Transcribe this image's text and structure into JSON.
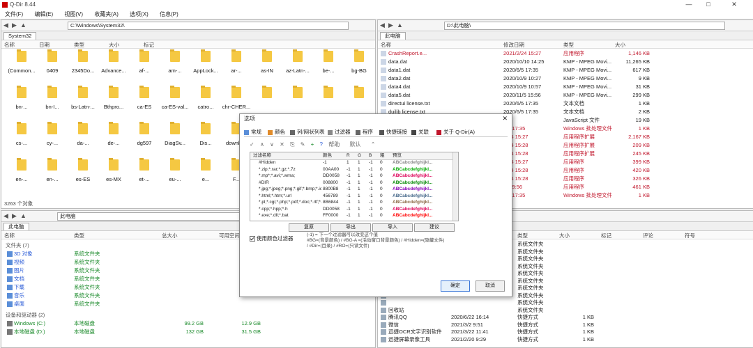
{
  "window": {
    "title": "Q-Dir 8.44"
  },
  "menu": [
    "文件(F)",
    "编辑(E)",
    "视图(V)",
    "收藏夹(A)",
    "选项(X)",
    "信息(P)"
  ],
  "pane_tl": {
    "path": "C:\\Windows\\System32\\",
    "tab": "System32",
    "cols": [
      "名称",
      "日期",
      "类型",
      "大小",
      "标记"
    ],
    "items": [
      "(Common...",
      "0409",
      "2345Do...",
      "Advance...",
      "af-...",
      "am-...",
      "AppLock...",
      "ar-...",
      "as-IN",
      "az-Latn-...",
      "be-...",
      "bg-BG",
      "bn-...",
      "bn-I...",
      "bs-Latn-...",
      "Bthpro...",
      "ca-ES",
      "ca-ES-val...",
      "catro...",
      "chr-CHER...",
      "",
      "",
      "",
      "",
      "cs-...",
      "cy-...",
      "da-...",
      "de-...",
      "dg597",
      "DiagSv...",
      "Dis...",
      "downla...",
      "",
      "",
      "",
      "",
      "en-...",
      "en-...",
      "es-ES",
      "es-MX",
      "et-...",
      "eu-...",
      "e...",
      "F...",
      "",
      "",
      "",
      ""
    ],
    "status": "3263 个对象"
  },
  "pane_tr": {
    "path": "D:\\此电脑\\",
    "tab": "此电脑",
    "cols": [
      "名称",
      "修改日期",
      "类型",
      "大小"
    ],
    "rows": [
      {
        "name": "CrashReport.e...",
        "date": "2021/2/24 15:27",
        "type": "应用程序",
        "size": "1,146 KB",
        "style": "red"
      },
      {
        "name": "data.dat",
        "date": "2020/10/10 14:25",
        "type": "KMP - MPEG Movi...",
        "size": "11,265 KB",
        "style": ""
      },
      {
        "name": "data1.dat",
        "date": "2020/6/5 17:35",
        "type": "KMP - MPEG Movi...",
        "size": "617 KB",
        "style": ""
      },
      {
        "name": "data2.dat",
        "date": "2020/10/9 10:27",
        "type": "KMP - MPEG Movi...",
        "size": "9 KB",
        "style": ""
      },
      {
        "name": "data4.dat",
        "date": "2020/10/9 10:57",
        "type": "KMP - MPEG Movi...",
        "size": "31 KB",
        "style": ""
      },
      {
        "name": "data5.dat",
        "date": "2020/11/5 15:56",
        "type": "KMP - MPEG Movi...",
        "size": "299 KB",
        "style": ""
      },
      {
        "name": "directui license.txt",
        "date": "2020/6/5 17:35",
        "type": "文本文档",
        "size": "1 KB",
        "style": ""
      },
      {
        "name": "duilib license.txt",
        "date": "2020/6/5 17:35",
        "type": "文本文档",
        "size": "2 KB",
        "style": ""
      },
      {
        "name": "",
        "date": "",
        "type": "JavaScript 文件",
        "size": "19 KB",
        "style": ""
      },
      {
        "name": "",
        "date": "6/5 17:35",
        "type": "Windows 批处理文件",
        "size": "1 KB",
        "style": "red"
      },
      {
        "name": "",
        "date": "2/24 15:27",
        "type": "应用程序扩展",
        "size": "2,167 KB",
        "style": "red"
      },
      {
        "name": "",
        "date": "2/24 15:28",
        "type": "应用程序扩展",
        "size": "209 KB",
        "style": "red"
      },
      {
        "name": "",
        "date": "2/24 15:28",
        "type": "应用程序扩展",
        "size": "245 KB",
        "style": "red"
      },
      {
        "name": "",
        "date": "2/24 15:27",
        "type": "应用程序",
        "size": "399 KB",
        "style": "red"
      },
      {
        "name": "",
        "date": "2/24 15:28",
        "type": "应用程序",
        "size": "420 KB",
        "style": "red"
      },
      {
        "name": "",
        "date": "2/24 15:28",
        "type": "应用程序",
        "size": "326 KB",
        "style": "red"
      },
      {
        "name": "",
        "date": "3/2 9:56",
        "type": "应用程序",
        "size": "461 KB",
        "style": "red"
      },
      {
        "name": "",
        "date": "6/5 17:35",
        "type": "Windows 批处理文件",
        "size": "1 KB",
        "style": "red"
      }
    ]
  },
  "pane_bl": {
    "path": "此电脑",
    "tab": "此电脑",
    "cols": [
      "名称",
      "类型",
      "总大小",
      "可用空间"
    ],
    "section_folders": "文件夹 (7)",
    "folders": [
      {
        "name": "3D 对象",
        "type": "系统文件夹"
      },
      {
        "name": "视频",
        "type": "系统文件夹"
      },
      {
        "name": "图片",
        "type": "系统文件夹"
      },
      {
        "name": "文档",
        "type": "系统文件夹"
      },
      {
        "name": "下载",
        "type": "系统文件夹"
      },
      {
        "name": "音乐",
        "type": "系统文件夹"
      },
      {
        "name": "桌面",
        "type": "系统文件夹"
      }
    ],
    "section_drives": "设备和驱动器 (2)",
    "drives": [
      {
        "name": "Windows (C:)",
        "type": "本地磁盘",
        "total": "99.2 GB",
        "free": "12.9 GB"
      },
      {
        "name": "本地磁盘 (D:)",
        "type": "本地磁盘",
        "total": "132 GB",
        "free": "31.5 GB"
      }
    ]
  },
  "pane_br": {
    "cols": [
      "类型",
      "大小",
      "标记",
      "评论",
      "符号"
    ],
    "rows": [
      {
        "name": "",
        "date": "",
        "type": "系统文件夹",
        "size": ""
      },
      {
        "name": "",
        "date": "",
        "type": "系统文件夹",
        "size": ""
      },
      {
        "name": "",
        "date": "",
        "type": "系统文件夹",
        "size": ""
      },
      {
        "name": "",
        "date": "",
        "type": "系统文件夹",
        "size": ""
      },
      {
        "name": "",
        "date": "",
        "type": "系统文件夹",
        "size": ""
      },
      {
        "name": "",
        "date": "",
        "type": "系统文件夹",
        "size": ""
      },
      {
        "name": "",
        "date": "",
        "type": "系统文件夹",
        "size": ""
      },
      {
        "name": "",
        "date": "",
        "type": "系统文件夹",
        "size": ""
      },
      {
        "name": "",
        "date": "",
        "type": "系统文件夹",
        "size": ""
      },
      {
        "name": "回收站",
        "date": "",
        "type": "系统文件夹",
        "size": ""
      },
      {
        "name": "腾讯QQ",
        "date": "2020/6/22 16:14",
        "type": "快捷方式",
        "size": "1 KB"
      },
      {
        "name": "微信",
        "date": "2021/3/2 9:51",
        "type": "快捷方式",
        "size": "1 KB"
      },
      {
        "name": "迅捷OCR文字识别软件",
        "date": "2021/3/22 11:41",
        "type": "快捷方式",
        "size": "1 KB"
      },
      {
        "name": "迅捷屏幕录像工具",
        "date": "2021/2/20 9:29",
        "type": "快捷方式",
        "size": "1 KB"
      }
    ]
  },
  "dialog": {
    "title": "选项",
    "tabs": [
      "常规",
      "颜色",
      "列/网状列表",
      "过滤器",
      "程序",
      "快捷链接",
      "关联",
      "关于 Q-Dir(A)"
    ],
    "toolbar_help": "帮助",
    "toolbar_default": "默认",
    "table_cols": [
      "过滤名称",
      "颜色",
      "R",
      "G",
      "B",
      "粗",
      "预览"
    ],
    "filters": [
      {
        "name": "#Hidden",
        "color": "-1",
        "r": "1",
        "g": "1",
        "b": "-1",
        "w": "0",
        "preview": "ABCabcdefghijkl...",
        "pc": "#888888"
      },
      {
        "name": "*.zip;*.rar;*.gz;*.7z",
        "color": "00AA00",
        "r": "-1",
        "g": "1",
        "b": "-1",
        "w": "0",
        "preview": "ABCabcdefghijkl...",
        "pc": "#00aa00"
      },
      {
        "name": "*.mp*;*.avi;*.wma;",
        "color": "DD0058",
        "r": "-1",
        "g": "1",
        "b": "-1",
        "w": "0",
        "preview": "ABCabcdefghijkl...",
        "pc": "#dd0058"
      },
      {
        "name": "#DIR",
        "color": "008800",
        "r": "-1",
        "g": "1",
        "b": "-1",
        "w": "0",
        "preview": "ABCabcdefghijkl...",
        "pc": "#008800"
      },
      {
        "name": "*.jpg;*.jpeg;*.png;*.gif;*.bmp;*.ico",
        "color": "8800B8",
        "r": "-1",
        "g": "1",
        "b": "-1",
        "w": "0",
        "preview": "ABCabcdefghijkl...",
        "pc": "#8800b8"
      },
      {
        "name": "*.html;*.htm;*.url",
        "color": "456789",
        "r": "-1",
        "g": "1",
        "b": "-1",
        "w": "0",
        "preview": "ABCabcdefghijkl...",
        "pc": "#456789"
      },
      {
        "name": "*.pl;*.cgi;*.php;*.pdf;*.doc;*.rtf;*...",
        "color": "8B6844",
        "r": "-1",
        "g": "1",
        "b": "-1",
        "w": "0",
        "preview": "ABCabcdefghijkl...",
        "pc": "#8b6844"
      },
      {
        "name": "*.cpp;*.hpp;*.h",
        "color": "DD0058",
        "r": "-1",
        "g": "1",
        "b": "-1",
        "w": "0",
        "preview": "ABCabcdefghijkl...",
        "pc": "#dd0058"
      },
      {
        "name": "*.exe;*.dll;*.bat",
        "color": "FF0000",
        "r": "-1",
        "g": "1",
        "b": "-1",
        "w": "0",
        "preview": "ABCabcdefghijkl...",
        "pc": "#ff0000"
      }
    ],
    "buttons_row": [
      "复原",
      "导出",
      "导入",
      "建议"
    ],
    "use_filter_label": "使用颜色过滤器",
    "hint_text": "(-1) = 下一个过滤器可以改变这个值\n#BG=(背景颜色) / #BG-A =(活动窗口背景颜色) / #Hidden=(隐藏文件) / #Dir=(目录) / #RO=(只读文件)",
    "ok": "确定",
    "cancel": "取消"
  },
  "colors": {
    "accent": "#3b77d8",
    "red_text": "#c0162b",
    "green_text": "#1a8a2a",
    "folder": "#f5c842"
  }
}
